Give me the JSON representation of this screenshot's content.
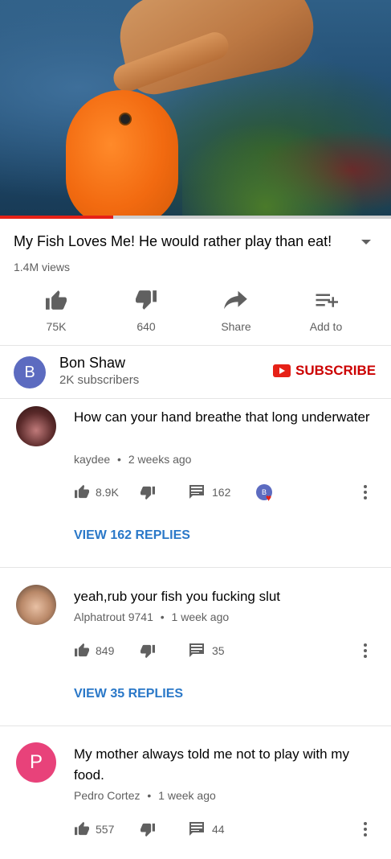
{
  "video": {
    "title": "My Fish Loves Me! He would rather play than eat!",
    "views": "1.4M views",
    "progress_fraction": 0.29
  },
  "actions": {
    "like": "75K",
    "dislike": "640",
    "share": "Share",
    "add_to": "Add to"
  },
  "channel": {
    "avatar_letter": "B",
    "name": "Bon Shaw",
    "subscribers": "2K subscribers",
    "subscribe_label": "SUBSCRIBE"
  },
  "comments": [
    {
      "text": "How can your hand breathe that long underwater",
      "author": "kaydee",
      "time": "2 weeks ago",
      "likes": "8.9K",
      "replies_count": "162",
      "view_replies": "VIEW 162 REPLIES",
      "creator_heart_letter": "B"
    },
    {
      "text": "yeah,rub your fish you fucking slut",
      "author": "Alphatrout 9741",
      "time": "1 week ago",
      "likes": "849",
      "replies_count": "35",
      "view_replies": "VIEW 35 REPLIES"
    },
    {
      "text": "My mother always  told me not to play with my food.",
      "author": "Pedro Cortez",
      "time": "1 week ago",
      "likes": "557",
      "replies_count": "44",
      "avatar_letter": "P"
    }
  ],
  "separator": "•",
  "colors": {
    "brand_red": "#e62117",
    "link_blue": "#2a78c8",
    "channel_avatar": "#5c6bc0",
    "pedro_avatar": "#e8427a"
  }
}
